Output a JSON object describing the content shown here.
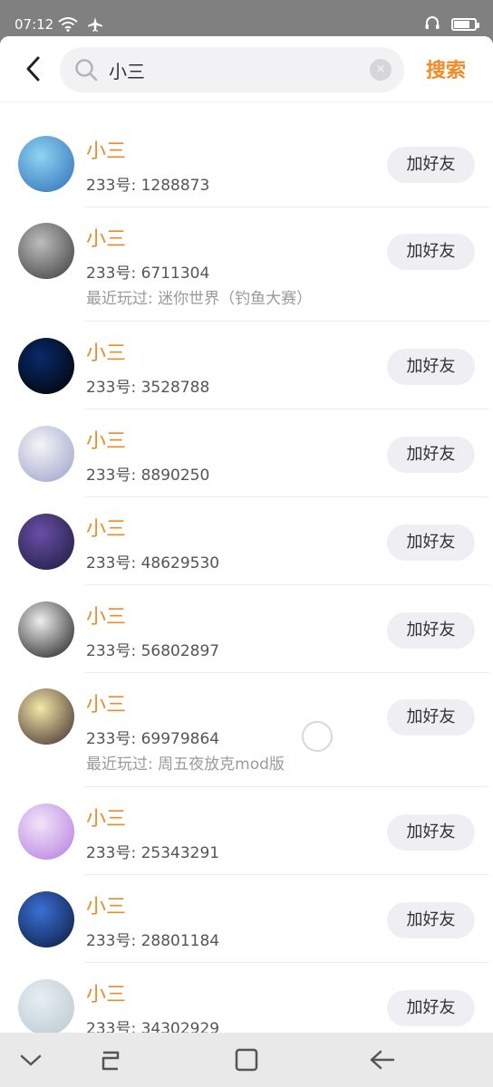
{
  "status_bar": {
    "time": "07:12"
  },
  "search": {
    "query": "小三",
    "button_label": "搜索"
  },
  "results": [
    {
      "name": "小三",
      "id_text": "233号: 1288873",
      "recent": "",
      "add_label": "加好友",
      "avatar_colors": [
        "#8fd3f4",
        "#2f6fb3"
      ]
    },
    {
      "name": "小三",
      "id_text": "233号: 6711304",
      "recent": "最近玩过: 迷你世界（钓鱼大赛）",
      "add_label": "加好友",
      "avatar_colors": [
        "#bdbdbd",
        "#3a3a3a"
      ]
    },
    {
      "name": "小三",
      "id_text": "233号: 3528788",
      "recent": "",
      "add_label": "加好友",
      "avatar_colors": [
        "#0a2a6a",
        "#000000"
      ]
    },
    {
      "name": "小三",
      "id_text": "233号: 8890250",
      "recent": "",
      "add_label": "加好友",
      "avatar_colors": [
        "#f4f4f8",
        "#9aa0c8"
      ]
    },
    {
      "name": "小三",
      "id_text": "233号: 48629530",
      "recent": "",
      "add_label": "加好友",
      "avatar_colors": [
        "#6a4ea8",
        "#1b1b3a"
      ]
    },
    {
      "name": "小三",
      "id_text": "233号: 56802897",
      "recent": "",
      "add_label": "加好友",
      "avatar_colors": [
        "#eeeeee",
        "#1a1a1a"
      ]
    },
    {
      "name": "小三",
      "id_text": "233号: 69979864",
      "recent": "最近玩过: 周五夜放克mod版",
      "add_label": "加好友",
      "avatar_colors": [
        "#f5e6a8",
        "#3a2a2a"
      ]
    },
    {
      "name": "小三",
      "id_text": "233号: 25343291",
      "recent": "",
      "add_label": "加好友",
      "avatar_colors": [
        "#f1e4f7",
        "#b57be0"
      ]
    },
    {
      "name": "小三",
      "id_text": "233号: 28801184",
      "recent": "",
      "add_label": "加好友",
      "avatar_colors": [
        "#3b6fd6",
        "#0b1a3a"
      ]
    },
    {
      "name": "小三",
      "id_text": "233号: 34302929",
      "recent": "",
      "add_label": "加好友",
      "avatar_colors": [
        "#e6eef2",
        "#b8c8d0"
      ]
    }
  ],
  "colors": {
    "accent": "#f28a26",
    "name": "#ef8a2a"
  }
}
